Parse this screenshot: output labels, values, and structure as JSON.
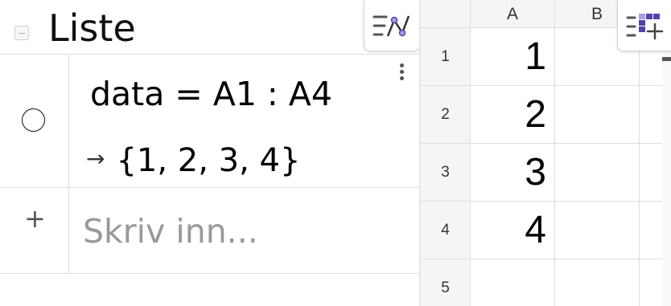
{
  "algebra": {
    "title": "Liste",
    "rows": [
      {
        "input": "data = A1 : A4",
        "output_arrow": "→",
        "output": "{1, 2, 3, 4}"
      }
    ],
    "add_icon": "+",
    "input_placeholder": "Skriv inn..."
  },
  "spreadsheet": {
    "columns": [
      "A",
      "B"
    ],
    "rows": [
      "1",
      "2",
      "3",
      "4",
      "5"
    ],
    "cells": {
      "A1": "1",
      "A2": "2",
      "A3": "3",
      "A4": "4"
    }
  },
  "icons": {
    "collapse": "collapse-icon",
    "graphics_toggle": "graphics-view-icon",
    "spreadsheet_toggle": "spreadsheet-view-icon",
    "more_menu": "more-vertical-icon",
    "visibility": "visibility-toggle-icon"
  },
  "colors": {
    "accent": "#5145a8",
    "accent_light": "#a89ee6",
    "grid": "#dddddd",
    "header_bg": "#f5f5f5"
  }
}
